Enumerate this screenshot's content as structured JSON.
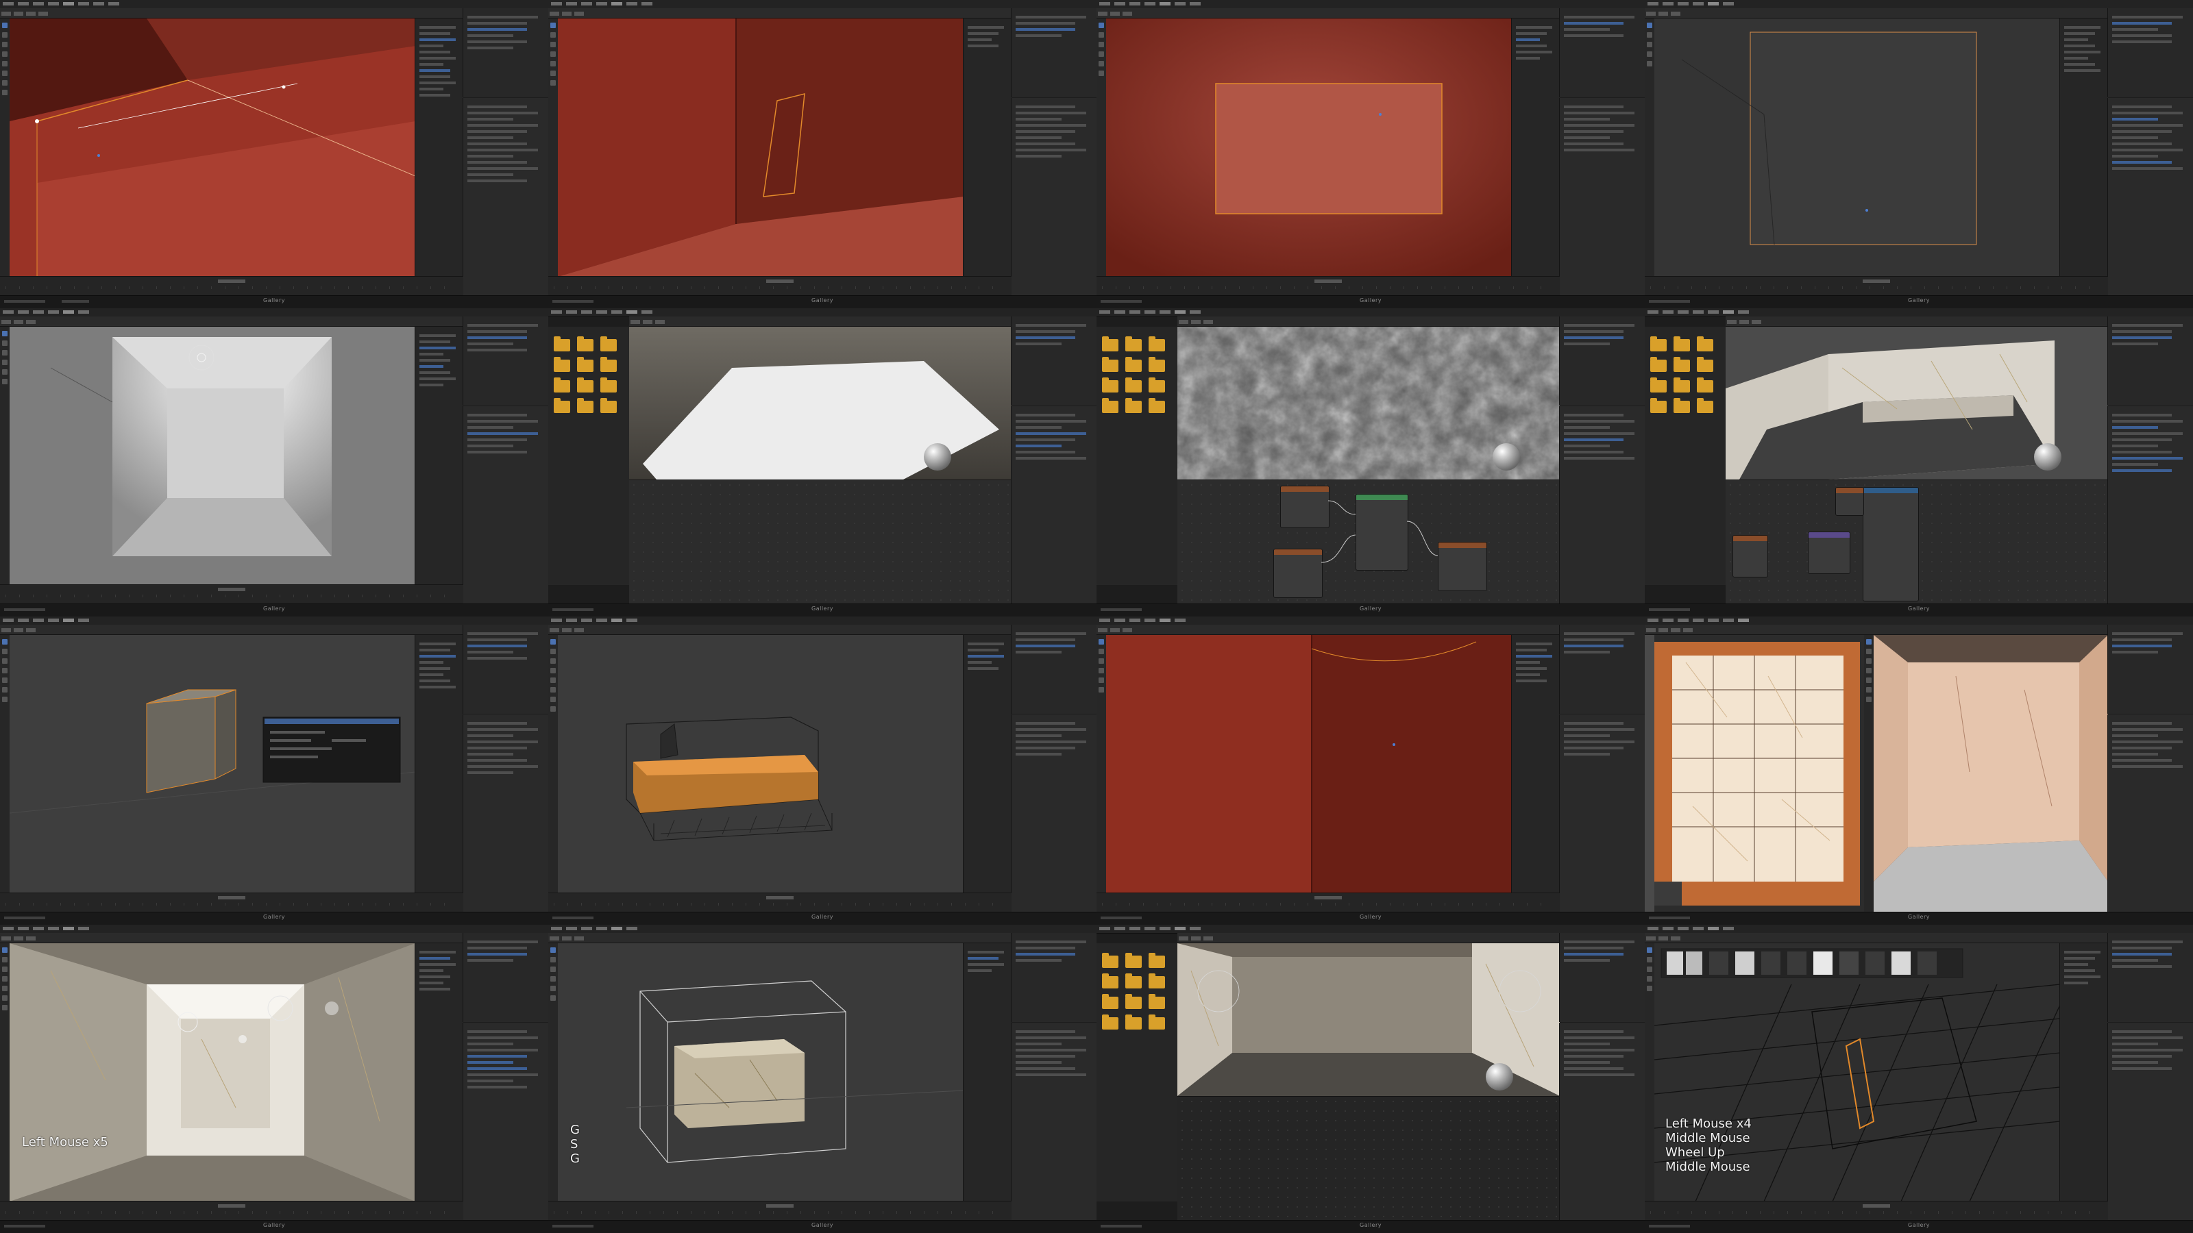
{
  "screens": {
    "s0": {
      "status": "Gallery"
    },
    "s1": {
      "status": "Gallery"
    },
    "s2": {
      "status": "Gallery"
    },
    "s3": {
      "status": "Gallery"
    },
    "s4": {
      "status": "Gallery"
    },
    "s5": {
      "status": "Gallery"
    },
    "s6": {
      "status": "Gallery"
    },
    "s7": {
      "status": "Gallery"
    },
    "s8": {
      "status": "Gallery"
    },
    "s9": {
      "status": "Gallery"
    },
    "s10": {
      "status": "Gallery"
    },
    "s11": {
      "status": "Gallery"
    },
    "s12": {
      "status": "Gallery"
    },
    "s13": {
      "status": "Gallery"
    },
    "s14": {
      "status": "Gallery"
    },
    "s15": {
      "status": "Gallery"
    }
  },
  "keystrokes": {
    "s12": "Left Mouse x5",
    "s13": [
      "G",
      "S",
      "G"
    ],
    "s15": [
      "Left Mouse x4",
      "Middle Mouse",
      "Wheel Up",
      "Middle Mouse"
    ]
  },
  "colors": {
    "wall_red": "#7a2419",
    "selection_orange": "#e2892a",
    "folder_yellow": "#d9a02a",
    "ui_dark": "#1d1d1d",
    "highlight_blue": "#3d5f94"
  },
  "icons": [
    "folder-icon",
    "gizmo-icon",
    "material-preview-icon",
    "light-icon"
  ]
}
